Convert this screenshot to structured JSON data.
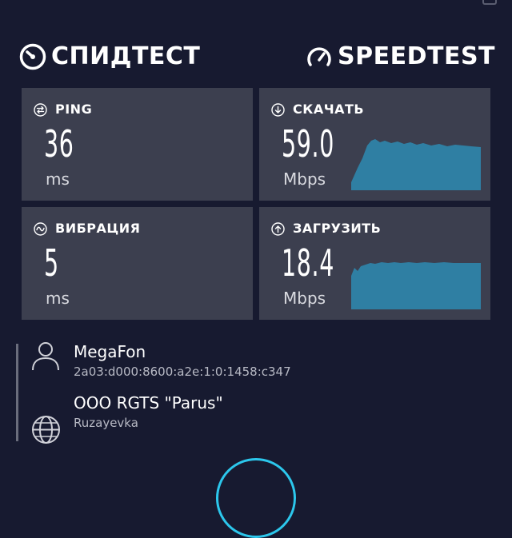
{
  "header": {
    "logo_left": "СПИДТЕСТ",
    "logo_right": "SPEEDTEST"
  },
  "metrics": {
    "ping": {
      "label": "PING",
      "value": "36",
      "unit": "ms",
      "icon": "ping-icon"
    },
    "download": {
      "label": "СКАЧАТЬ",
      "value": "59.0",
      "unit": "Mbps",
      "icon": "download-arrow-icon"
    },
    "jitter": {
      "label": "ВИБРАЦИЯ",
      "value": "5",
      "unit": "ms",
      "icon": "jitter-wave-icon"
    },
    "upload": {
      "label": "ЗАГРУЗИТЬ",
      "value": "18.4",
      "unit": "Mbps",
      "icon": "upload-arrow-icon"
    }
  },
  "connection": {
    "isp_name": "MegaFon",
    "ip": "2a03:d000:8600:a2e:1:0:1458:c347",
    "server_name": "OOO RGTS \"Parus\"",
    "server_city": "Ruzayevka"
  },
  "colors": {
    "background": "#171a30",
    "card": "#3c3f4f",
    "graph_fill": "#2f7fa3",
    "accent": "#2cc7ec"
  }
}
